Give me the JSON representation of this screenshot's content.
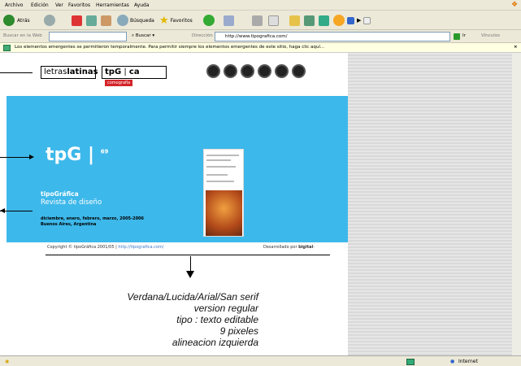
{
  "menu": [
    "Archivo",
    "Edición",
    "Ver",
    "Favoritos",
    "Herramientas",
    "Ayuda"
  ],
  "toolbar": {
    "back": "Atrás",
    "search": "Búsqueda",
    "favorites": "Favoritos"
  },
  "addressbar": {
    "search_label": "Buscar en la Web",
    "search_button": "Buscar",
    "address_label": "Dirección",
    "url": "http://www.tipografica.com/",
    "go": "Ir",
    "links": "Vínculos"
  },
  "infobar": {
    "text": "Los elementos emergentes se permitieron temporalmente. Para permitir siempre los elementos emergentes de este sitio, haga clic aquí..."
  },
  "site": {
    "logo1_a": "letras",
    "logo1_b": "latinas",
    "logo2_a": "tpG",
    "logo2_b": "ca",
    "logo2_red": "comografía",
    "hero_title": "tpG",
    "hero_issue": "69",
    "line1": "tipoGráfica",
    "line2": "Revista de diseño",
    "line3": "diciembre, enero, febrero, marzo, 2005-2006",
    "line4": "Buenos Aires, Argentina",
    "copyright": "Copyright © tipoGráfica 2001/05 | ",
    "copyright_link": "http://tipografica.com/",
    "dev": "Desarrollado por ",
    "dev_brand": "bigital",
    "dev_tail": "-"
  },
  "annotation": [
    "Verdana/Lucida/Arial/San serif",
    "version regular",
    "tipo : texto editable",
    "9 pixeles",
    "alineacion izquierda"
  ],
  "status": {
    "zone": "Internet"
  }
}
